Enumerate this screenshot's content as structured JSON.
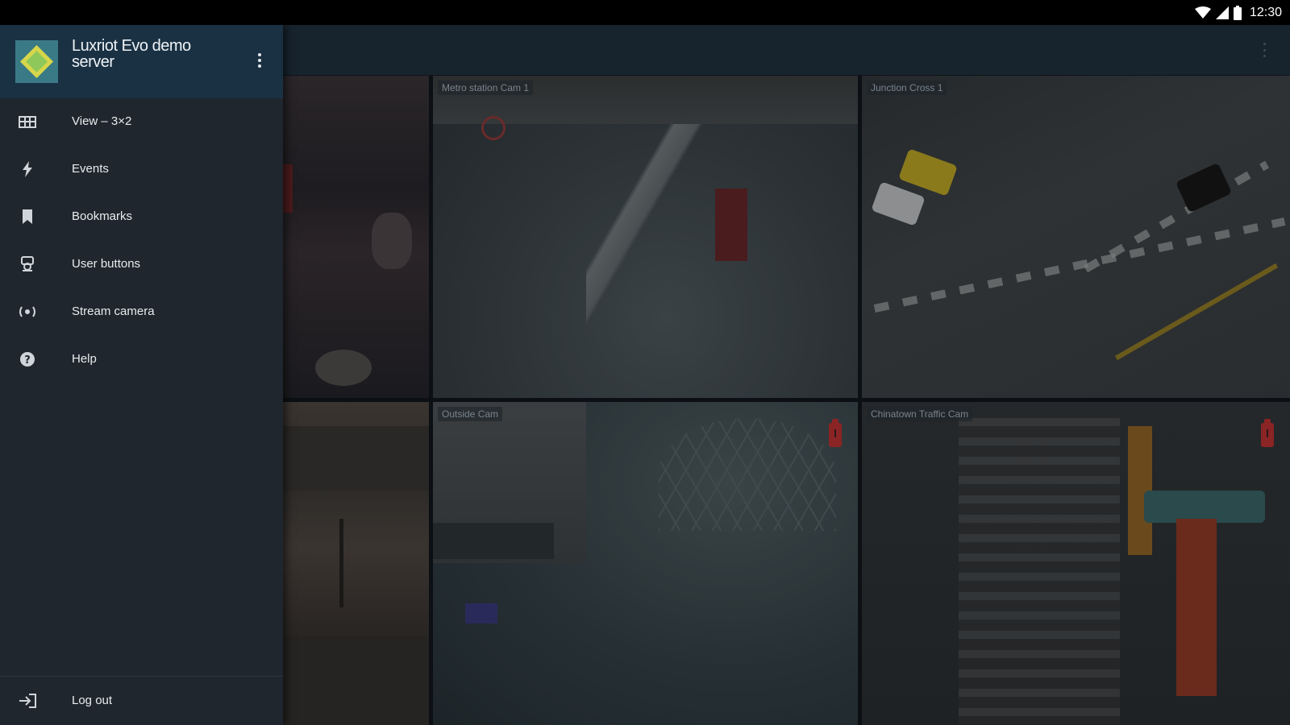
{
  "status_bar": {
    "time": "12:30",
    "icons": [
      "wifi-icon",
      "signal-icon",
      "battery-icon"
    ]
  },
  "drawer": {
    "server_name": "Luxriot Evo demo server",
    "items": [
      {
        "label": "View – 3×2",
        "icon": "grid-view-icon"
      },
      {
        "label": "Events",
        "icon": "lightning-icon"
      },
      {
        "label": "Bookmarks",
        "icon": "bookmark-icon"
      },
      {
        "label": "User buttons",
        "icon": "user-buttons-icon"
      },
      {
        "label": "Stream camera",
        "icon": "stream-camera-icon"
      },
      {
        "label": "Help",
        "icon": "help-icon"
      }
    ],
    "logout_label": "Log out"
  },
  "cameras": [
    {
      "label": ""
    },
    {
      "label": "Metro station Cam 1"
    },
    {
      "label": "Junction Cross 1"
    },
    {
      "label": ""
    },
    {
      "label": "Outside Cam"
    },
    {
      "label": "Chinatown Traffic Cam"
    }
  ],
  "colors": {
    "drawer_bg": "#1f262d",
    "header_bg": "#1a3144",
    "app_bar_bg": "#17232d",
    "alert": "#8b2424"
  }
}
